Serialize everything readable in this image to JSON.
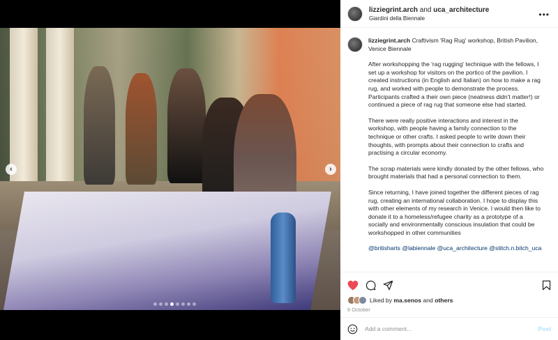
{
  "post": {
    "username": "lizziegrint.arch",
    "connector": "and",
    "collaborator": "uca_architecture",
    "location": "Giardini della Biennale"
  },
  "caption": {
    "username": "lizziegrint.arch",
    "title": "Craftivism 'Rag Rug' workshop, British Pavilion, Venice Biennale",
    "paragraphs": [
      "After workshopping the 'rag rugging' technique with the fellows, I set up a workshop for visitors on the portico of the pavilion. I created instructions (in English and Italian) on how to make a rag rug, and worked with people to demonstrate the process. Participants crafted a their own piece (neatness didn't matter!) or continued a piece of rag rug that someone else had started.",
      "There were really positive interactions and interest in the workshop, with people having a family connection to the technique or other crafts. I asked people to write down their thoughts, with prompts about their connection to crafts and practising a circular economy.",
      "The scrap materials were kindly donated by the other fellows, who brought materials that had a personal connection to them.",
      "Since returning, I have joined together the different pieces of rag rug, creating an international collaboration. I hope to display this with other elements of my research in Venice. I would then like to donate it to a homeless/refugee charity as a prototype of a socially and environmentally conscious insulation that could be workshopped in other communities"
    ],
    "tags": "@britisharts @labiennale @uca_architecture @stitch.n.bitch_uca"
  },
  "likes": {
    "prefix": "Liked by",
    "user": "ma.senos",
    "connector": "and",
    "others": "others"
  },
  "date": "6 October",
  "comment": {
    "placeholder": "Add a comment...",
    "post_label": "Post"
  },
  "icons": {
    "more": "more-options-icon",
    "like": "heart-icon",
    "comment": "comment-icon",
    "share": "share-icon",
    "save": "bookmark-icon",
    "emoji": "emoji-icon",
    "prev": "chevron-left-icon",
    "next": "chevron-right-icon"
  },
  "colors": {
    "like": "#ed4956",
    "tag": "#00376b",
    "post_disabled": "#b2dffc"
  },
  "carousel": {
    "total": 8,
    "active": 3
  },
  "photo_alt": ""
}
